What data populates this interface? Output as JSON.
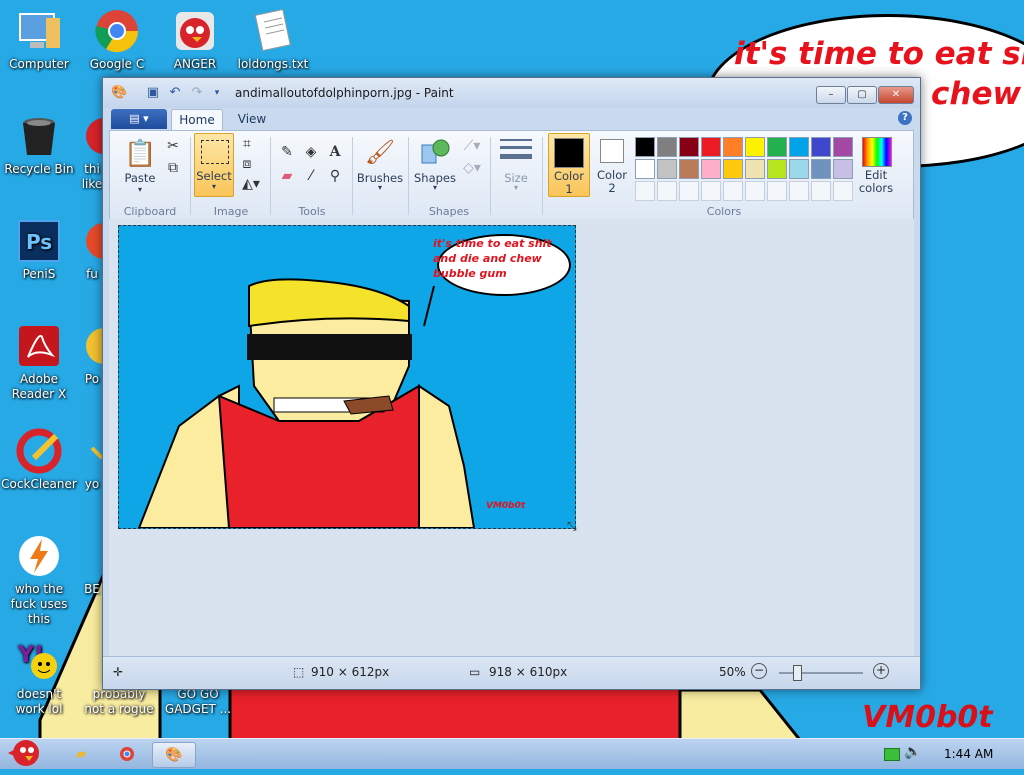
{
  "desktop": {
    "icons": [
      {
        "label": "Computer"
      },
      {
        "label": "Google C"
      },
      {
        "label": "ANGER"
      },
      {
        "label": "loldongs.txt"
      },
      {
        "label": "Recycle Bin"
      },
      {
        "label": "thi like"
      },
      {
        "label": "PeniS"
      },
      {
        "label": "fu"
      },
      {
        "label": "Adobe Reader X"
      },
      {
        "label": "Po"
      },
      {
        "label": "CockCleaner"
      },
      {
        "label": "yo"
      },
      {
        "label": "who the fuck uses this"
      },
      {
        "label": "BE"
      },
      {
        "label": "doesn't work lol"
      },
      {
        "label": "probably not a rogue"
      },
      {
        "label": "GO GO GADGET ..."
      }
    ],
    "wallpaper": {
      "bubble_line1": "it's time to eat shit",
      "bubble_line2": "chew",
      "signature": "VM0b0t"
    }
  },
  "paint": {
    "title": "andimalloutofdolphinporn.jpg - Paint",
    "tabs": [
      "Home",
      "View"
    ],
    "groups": {
      "clipboard": "Clipboard",
      "image": "Image",
      "tools": "Tools",
      "shapes": "Shapes",
      "colors": "Colors"
    },
    "buttons": {
      "paste": "Paste",
      "select": "Select",
      "brushes": "Brushes",
      "shapes": "Shapes",
      "size": "Size",
      "color1": "Color 1",
      "color2": "Color 2",
      "edit_colors": "Edit colors"
    },
    "palette_row1": [
      "#000000",
      "#7f7f7f",
      "#880015",
      "#ed1c24",
      "#ff7f27",
      "#fff200",
      "#22b14c",
      "#00a2e8",
      "#3f48cc",
      "#a349a4"
    ],
    "palette_row2": [
      "#ffffff",
      "#c3c3c3",
      "#b97a57",
      "#ffaec9",
      "#ffc90e",
      "#efe4b0",
      "#b5e61d",
      "#99d9ea",
      "#7092be",
      "#c8bfe7"
    ],
    "image_caption": "it's time to eat shit and die and chew bubble gum",
    "image_signature": "VM0b0t",
    "status": {
      "selection_size": "910 × 612px",
      "image_size": "918 × 610px",
      "zoom": "50%"
    }
  },
  "taskbar": {
    "clock": "1:44 AM"
  }
}
